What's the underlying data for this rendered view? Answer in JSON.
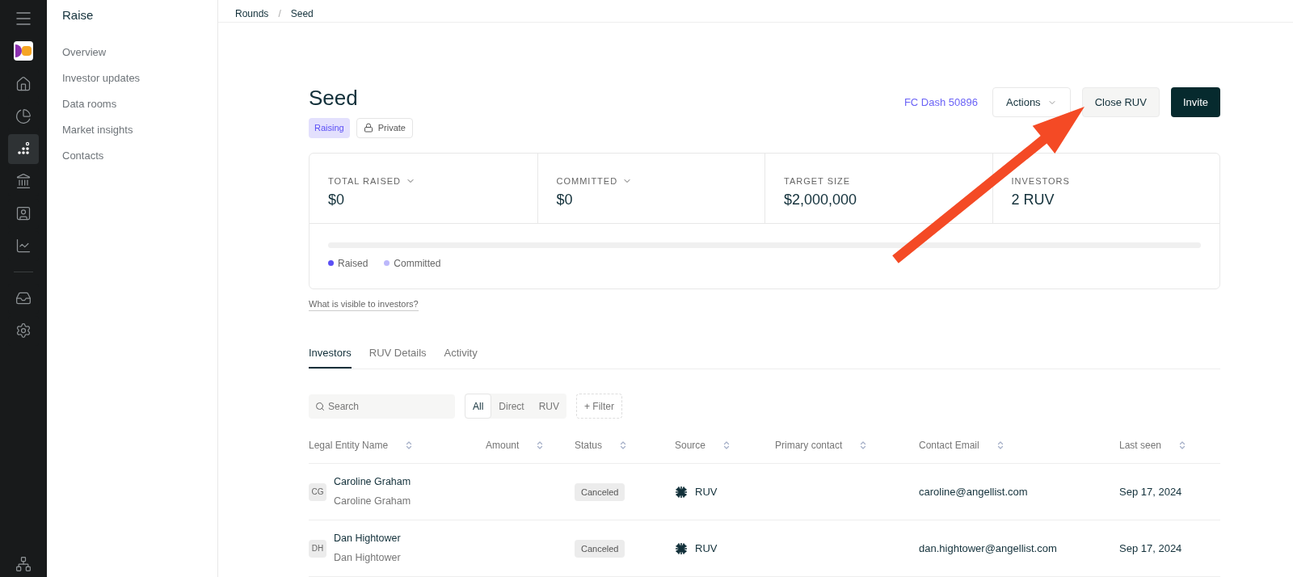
{
  "rail": {
    "primary": [
      {
        "kind": "home",
        "selected": false
      },
      {
        "kind": "pie",
        "selected": false
      },
      {
        "kind": "dots",
        "selected": true
      },
      {
        "kind": "bank",
        "selected": false
      },
      {
        "kind": "contact",
        "selected": false
      },
      {
        "kind": "chart",
        "selected": false
      }
    ],
    "secondary": [
      {
        "kind": "inbox",
        "selected": false
      },
      {
        "kind": "settings",
        "selected": false
      }
    ]
  },
  "sidebar": {
    "title": "Raise",
    "items": [
      {
        "label": "Overview",
        "selected": false
      },
      {
        "label": "Investor updates",
        "selected": false
      },
      {
        "label": "Data rooms",
        "selected": false
      },
      {
        "label": "Market insights",
        "selected": false
      },
      {
        "label": "Contacts",
        "selected": false
      }
    ]
  },
  "breadcrumb": {
    "items": [
      "Rounds",
      "Seed"
    ],
    "separator": "/"
  },
  "header": {
    "title": "Seed",
    "status": "Raising",
    "visibility": "Private",
    "link": "FC Dash 50896",
    "actions": "Actions",
    "close": "Close RUV",
    "invite": "Invite"
  },
  "stats": [
    {
      "label": "TOTAL RAISED",
      "value": "$0",
      "dropdown": true
    },
    {
      "label": "COMMITTED",
      "value": "$0",
      "dropdown": true
    },
    {
      "label": "TARGET SIZE",
      "value": "$2,000,000",
      "dropdown": false
    },
    {
      "label": "INVESTORS",
      "value": "2 RUV",
      "dropdown": false
    }
  ],
  "progress": {
    "level": 0,
    "legend": [
      {
        "label": "Raised",
        "color": "#5b4ff5"
      },
      {
        "label": "Committed",
        "color": "#bcb8fb"
      }
    ]
  },
  "visibility_link": "What is visible to investors?",
  "tabs": [
    {
      "label": "Investors",
      "selected": true
    },
    {
      "label": "RUV Details",
      "selected": false
    },
    {
      "label": "Activity",
      "selected": false
    }
  ],
  "search": {
    "placeholder": "Search"
  },
  "segments": [
    {
      "label": "All",
      "selected": true
    },
    {
      "label": "Direct",
      "selected": false
    },
    {
      "label": "RUV",
      "selected": false
    }
  ],
  "filter": "+ Filter",
  "table": {
    "columns": [
      "Legal Entity Name",
      "Amount",
      "Status",
      "Source",
      "Primary contact",
      "Contact Email",
      "Last seen"
    ],
    "rows": [
      {
        "initials": "CG",
        "name": "Caroline Graham",
        "entity": "Caroline Graham",
        "status": "Canceled",
        "source": "RUV",
        "email": "caroline@angellist.com",
        "last_seen": "Sep 17, 2024"
      },
      {
        "initials": "DH",
        "name": "Dan Hightower",
        "entity": "Dan Hightower",
        "status": "Canceled",
        "source": "RUV",
        "email": "dan.hightower@angellist.com",
        "last_seen": "Sep 17, 2024"
      }
    ]
  }
}
